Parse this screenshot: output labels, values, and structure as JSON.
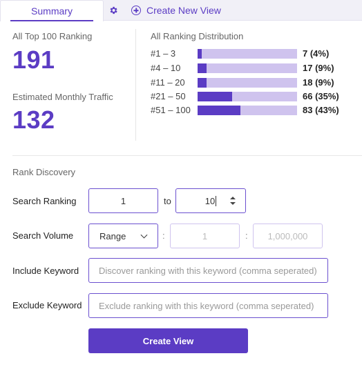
{
  "tabs": {
    "summary_label": "Summary",
    "settings_icon": "gear-icon",
    "create_label": "Create New View",
    "create_icon": "plus-circle-icon"
  },
  "stats": {
    "top_ranking_label": "All Top 100 Ranking",
    "top_ranking_value": "191",
    "traffic_label": "Estimated Monthly Traffic",
    "traffic_value": "132"
  },
  "distribution": {
    "title": "All Ranking Distribution",
    "rows": [
      {
        "range": "#1 – 3",
        "count": "7 (4%)",
        "percent": 4
      },
      {
        "range": "#4 – 10",
        "count": "17 (9%)",
        "percent": 9
      },
      {
        "range": "#11 – 20",
        "count": "18 (9%)",
        "percent": 9
      },
      {
        "range": "#21 – 50",
        "count": "66 (35%)",
        "percent": 35
      },
      {
        "range": "#51 – 100",
        "count": "83 (43%)",
        "percent": 43
      }
    ],
    "colors": {
      "fill": "#5b3cc4",
      "track": "#cfc3ee"
    }
  },
  "form": {
    "section_title": "Rank Discovery",
    "search_ranking": {
      "label": "Search Ranking",
      "from": "1",
      "to_label": "to",
      "to": "10"
    },
    "search_volume": {
      "label": "Search Volume",
      "mode": "Range",
      "separator": ":",
      "min_placeholder": "1",
      "max_placeholder": "1,000,000"
    },
    "include_keyword": {
      "label": "Include Keyword",
      "placeholder": "Discover ranking with this keyword (comma seperated)"
    },
    "exclude_keyword": {
      "label": "Exclude Keyword",
      "placeholder": "Exclude ranking with this keyword (comma seperated)"
    },
    "submit_label": "Create View"
  },
  "accent_color": "#5b3cc4"
}
